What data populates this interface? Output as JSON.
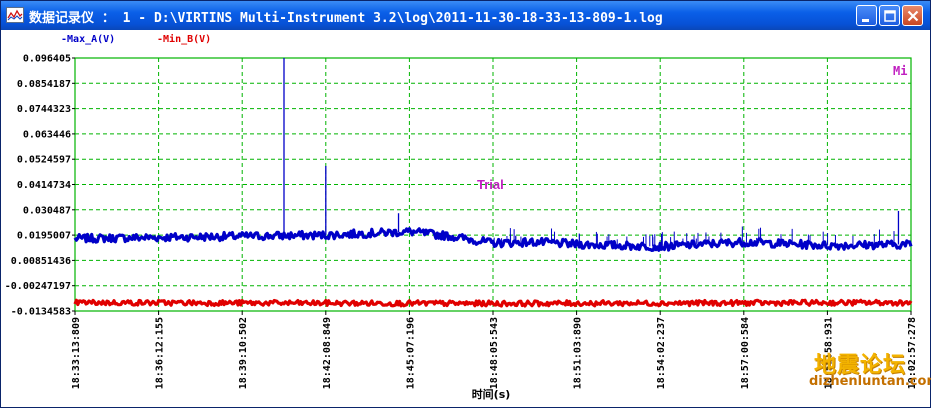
{
  "window": {
    "title": "数据记录仪 ： 1 - D:\\VIRTINS Multi-Instrument 3.2\\log\\2011-11-30-18-33-13-809-1.log",
    "buttons": {
      "minimize": "minimize-icon",
      "maximize": "maximize-icon",
      "close": "close-icon"
    }
  },
  "chart_data": {
    "type": "line",
    "xlabel": "时间(s)",
    "ylabel": "",
    "corner_label": "Mi",
    "trial_label": "Trial",
    "y_ticks": [
      "0.096405",
      "0.0854187",
      "0.0744323",
      "0.063446",
      "0.0524597",
      "0.0414734",
      "0.030487",
      "0.0195007",
      "0.00851436",
      "-0.00247197",
      "-0.0134583"
    ],
    "ylim": [
      -0.0134583,
      0.096405
    ],
    "x_ticks": [
      "18:33:13:809",
      "18:36:12:155",
      "18:39:10:502",
      "18:42:08:849",
      "18:45:07:196",
      "18:48:05:543",
      "18:51:03:890",
      "18:54:02:237",
      "18:57:00:584",
      "18:59:58:931",
      "19:02:57:278"
    ],
    "grid": true,
    "legend_placement": "top-left",
    "series": [
      {
        "name": "Max_A(V)",
        "color": "#0000c8",
        "x": [
          0,
          1,
          2,
          3,
          4,
          4.5,
          5,
          5.5,
          6,
          7,
          8,
          9,
          10
        ],
        "y": [
          0.018,
          0.0185,
          0.019,
          0.0195,
          0.021,
          0.019,
          0.016,
          0.0165,
          0.0155,
          0.0145,
          0.0165,
          0.015,
          0.0155
        ],
        "spikes": [
          {
            "x": 2.5,
            "y": 0.0964
          },
          {
            "x": 3.0,
            "y": 0.0495
          },
          {
            "x": 3.87,
            "y": 0.029
          },
          {
            "x": 9.85,
            "y": 0.03
          }
        ]
      },
      {
        "name": "Min_B(V)",
        "color": "#e00000",
        "x": [
          0,
          5,
          10
        ],
        "y": [
          -0.0098,
          -0.0102,
          -0.0098
        ]
      }
    ]
  },
  "watermark": {
    "line1": "地震论坛",
    "line2": "dizhenluntan.com"
  }
}
